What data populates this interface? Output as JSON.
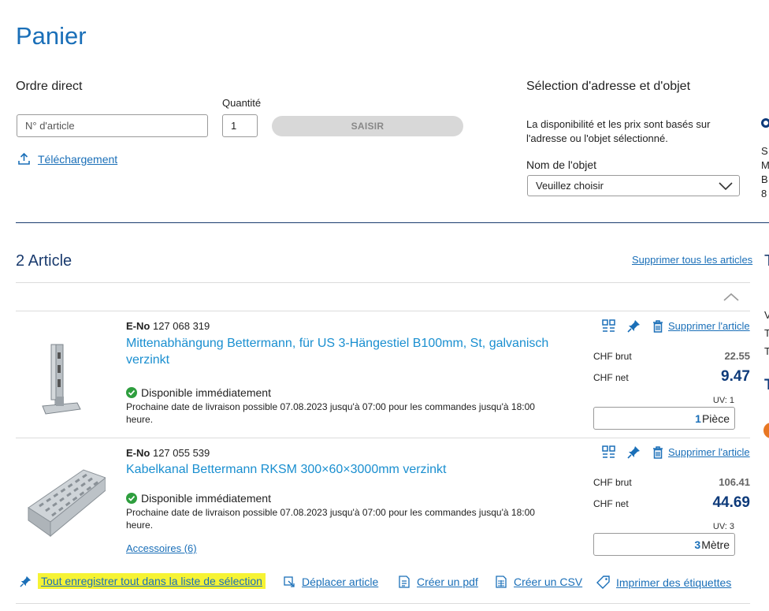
{
  "page": {
    "title": "Panier"
  },
  "direct_order": {
    "label": "Ordre direct",
    "article_placeholder": "N° d'article",
    "quantity_label": "Quantité",
    "quantity_value": "1",
    "submit_label": "SAISIR",
    "upload_label": "Téléchargement"
  },
  "address": {
    "title": "Sélection d'adresse et d'objet",
    "info_line1": "La disponibilité et les prix sont basés sur",
    "info_line2": "l'adresse ou l'objet sélectionné.",
    "object_label": "Nom de l'objet",
    "object_select": "Veuillez choisir",
    "cut_letters": [
      "S",
      "M",
      "B",
      "8"
    ]
  },
  "cart": {
    "count_title": "2 Article",
    "delete_all": "Supprimer tous les articles",
    "items": [
      {
        "eno_label": "E-No",
        "eno": "127 068 319",
        "title_line1": "Mittenabhängung Bettermann, für US 3-Hängestiel B100mm, St, galvanisch",
        "title_line2": "verzinkt",
        "availability": "Disponible immédiatement",
        "delivery_line1": "Prochaine date de livraison possible 07.08.2023 jusqu'à 07:00 pour les commandes jusqu'à 18:00",
        "delivery_line2": "heure.",
        "delete_label": "Supprimer l'article",
        "brut_label": "CHF brut",
        "brut_value": "22.55",
        "net_label": "CHF net",
        "net_value": "9.47",
        "uv": "UV: 1",
        "qty": "1",
        "unit": "Pièce"
      },
      {
        "eno_label": "E-No",
        "eno": "127 055 539",
        "title_line1": "Kabelkanal Bettermann RKSM 300×60×3000mm verzinkt",
        "availability": "Disponible immédiatement",
        "delivery_line1": "Prochaine date de livraison possible 07.08.2023 jusqu'à 07:00 pour les commandes jusqu'à 18:00",
        "delivery_line2": "heure.",
        "accessories": "Accessoires (6)",
        "delete_label": "Supprimer l'article",
        "brut_label": "CHF brut",
        "brut_value": "106.41",
        "net_label": "CHF net",
        "net_value": "44.69",
        "uv": "UV: 3",
        "qty": "3",
        "unit": "Mètre"
      }
    ]
  },
  "bottom_actions": {
    "save_all": "Tout enregistrer tout dans la liste de sélection",
    "move": "Déplacer article",
    "pdf": "Créer un pdf",
    "csv": "Créer un CSV",
    "labels": "Imprimer des étiquettes"
  },
  "right_cut": {
    "letters": [
      "T",
      "V",
      "T",
      "T",
      "T"
    ]
  },
  "colors": {
    "accent": "#1a6fb8",
    "net_price": "#0d3a7a",
    "available": "#2e9e3e",
    "highlight": "#f6f334",
    "orange": "#e87722"
  }
}
